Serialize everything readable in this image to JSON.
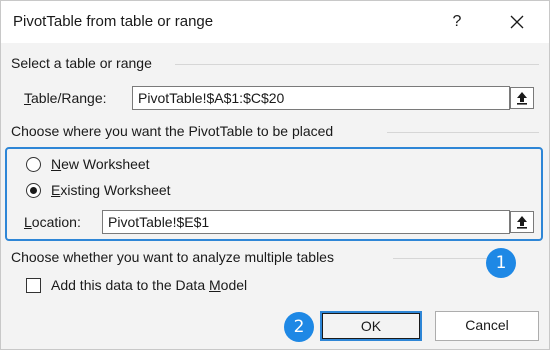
{
  "window": {
    "title": "PivotTable from table or range",
    "help_label": "?"
  },
  "source": {
    "section_label": "Select a table or range",
    "field_label_accel": "T",
    "field_label_rest": "able/Range:",
    "value": "PivotTable!$A$1:$C$20"
  },
  "placement": {
    "section_label": "Choose where you want the PivotTable to be placed",
    "options": [
      {
        "accel": "N",
        "rest": "ew Worksheet",
        "selected": false
      },
      {
        "accel": "E",
        "rest": "xisting Worksheet",
        "selected": true
      }
    ],
    "location_label_accel": "L",
    "location_label_rest": "ocation:",
    "location_value": "PivotTable!$E$1"
  },
  "multiple_tables": {
    "section_label": "Choose whether you want to analyze multiple tables",
    "checkbox_label_prefix": "Add this data to the Data ",
    "checkbox_label_accel": "M",
    "checkbox_label_suffix": "odel",
    "checked": false
  },
  "callouts": {
    "one": "1",
    "two": "2"
  },
  "buttons": {
    "ok": "OK",
    "cancel": "Cancel"
  },
  "colors": {
    "accent": "#2e86d6",
    "badge": "#1e88e5"
  }
}
